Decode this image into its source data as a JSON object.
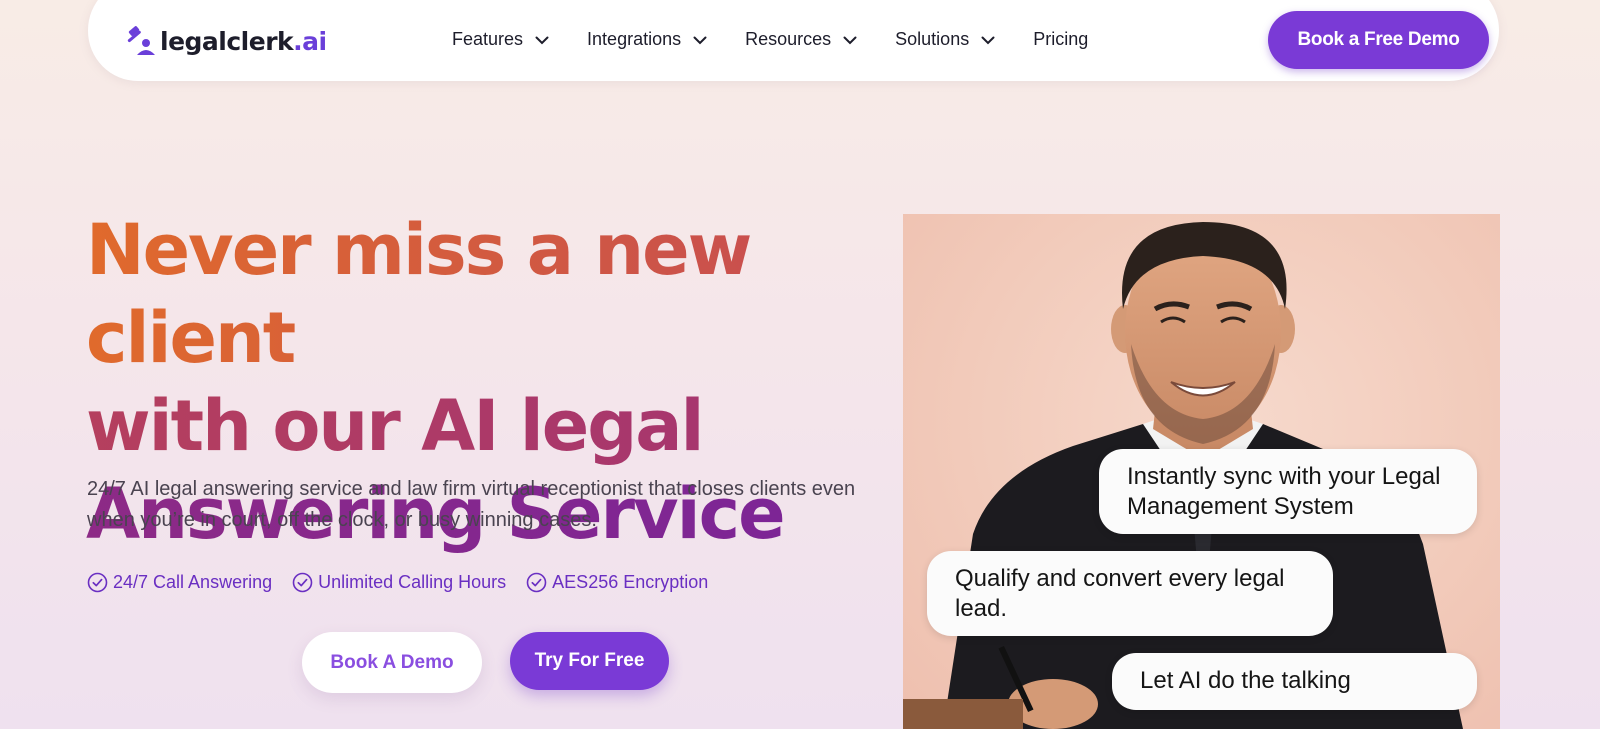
{
  "nav": {
    "logo_main": "legalclerk",
    "logo_suffix": ".ai",
    "items": [
      {
        "label": "Features",
        "has_dropdown": true
      },
      {
        "label": "Integrations",
        "has_dropdown": true
      },
      {
        "label": "Resources",
        "has_dropdown": true
      },
      {
        "label": "Solutions",
        "has_dropdown": true
      },
      {
        "label": "Pricing",
        "has_dropdown": false
      }
    ],
    "cta_label": "Book a Free Demo"
  },
  "hero": {
    "title_line1": "Never miss a new client",
    "title_line2": "with our AI legal",
    "title_line3": "Answering Service",
    "subtitle": "24/7 AI legal answering service and law firm virtual receptionist that closes clients even when you’re in court, off the clock, or busy winning cases.",
    "features": [
      "24/7 Call Answering",
      "Unlimited Calling Hours",
      "AES256 Encryption"
    ],
    "secondary_button": "Book A Demo",
    "primary_button": "Try For Free"
  },
  "bubbles": {
    "b1": "Instantly sync with your Legal Management System",
    "b2": "Qualify and convert every legal lead.",
    "b3": "Let AI do the talking"
  },
  "colors": {
    "accent": "#7a3ad6",
    "feature_text": "#6a2fc2",
    "title_start": "#e06a2c",
    "title_end": "#7a2498"
  },
  "icons": {
    "logo": "gavel-person-icon",
    "dropdown": "chevron-down-icon",
    "feature": "check-circle-icon"
  }
}
